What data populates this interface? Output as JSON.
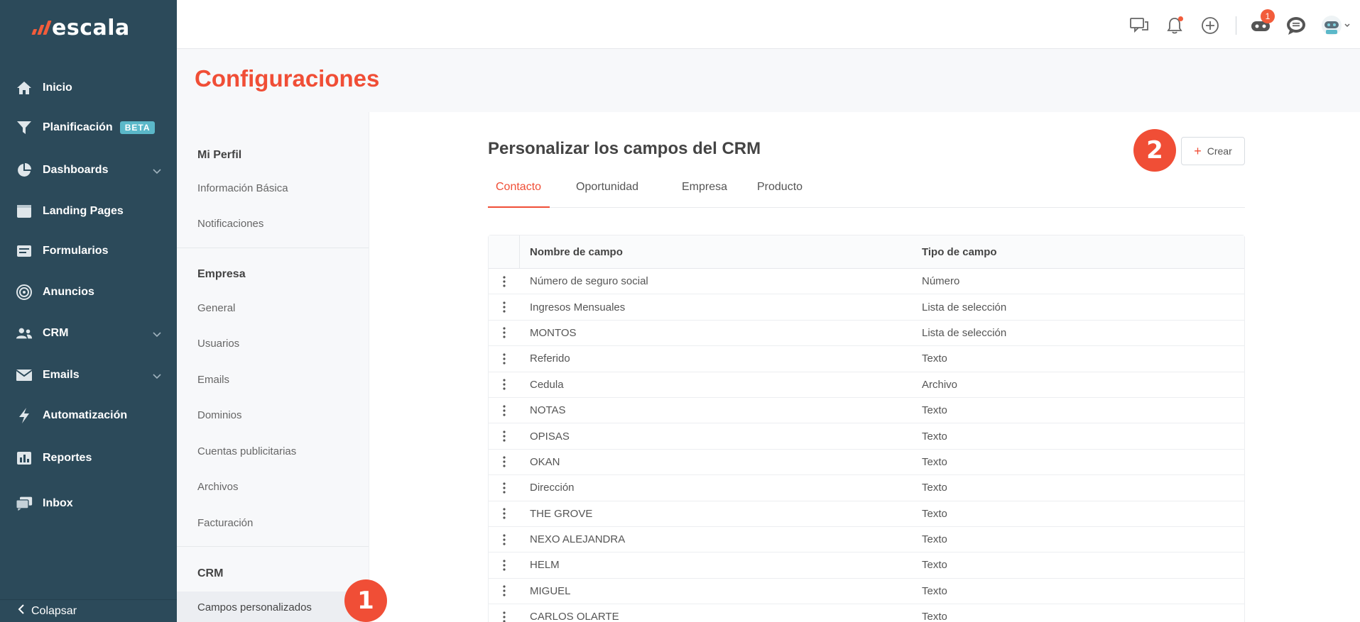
{
  "brand": {
    "name": "escala",
    "accent": "#f04e36",
    "sidebar_bg": "#2c4a5a"
  },
  "sidebar": {
    "items": [
      {
        "label": "Inicio",
        "icon": "home-icon"
      },
      {
        "label": "Planificación",
        "icon": "filter-icon",
        "badge": "BETA"
      },
      {
        "label": "Dashboards",
        "icon": "pie-chart-icon",
        "expandable": true
      },
      {
        "label": "Landing Pages",
        "icon": "browser-icon"
      },
      {
        "label": "Formularios",
        "icon": "form-icon"
      },
      {
        "label": "Anuncios",
        "icon": "target-icon"
      },
      {
        "label": "CRM",
        "icon": "users-icon",
        "expandable": true
      },
      {
        "label": "Emails",
        "icon": "mail-icon",
        "expandable": true
      },
      {
        "label": "Automatización",
        "icon": "lightning-icon"
      },
      {
        "label": "Reportes",
        "icon": "bar-chart-icon"
      },
      {
        "label": "Inbox",
        "icon": "inbox-icon"
      }
    ],
    "collapse_label": "Colapsar"
  },
  "topbar": {
    "icons": [
      "chat-icon",
      "bell-icon",
      "add-circle-icon",
      "robot-icon",
      "support-chat-icon",
      "avatar-icon"
    ],
    "notification_count": "1"
  },
  "page": {
    "title": "Configuraciones"
  },
  "submenu": {
    "sections": [
      {
        "title": "Mi Perfil",
        "items": [
          "Información Básica",
          "Notificaciones"
        ]
      },
      {
        "title": "Empresa",
        "items": [
          "General",
          "Usuarios",
          "Emails",
          "Dominios",
          "Cuentas publicitarias",
          "Archivos",
          "Facturación"
        ]
      },
      {
        "title": "CRM",
        "items": [
          "Campos personalizados"
        ]
      }
    ],
    "active_item": "Campos personalizados"
  },
  "main": {
    "title": "Personalizar los campos del CRM",
    "create_label": "Crear",
    "tabs": [
      "Contacto",
      "Oportunidad",
      "Empresa",
      "Producto"
    ],
    "active_tab": "Contacto",
    "table": {
      "headers": [
        "Nombre de campo",
        "Tipo de campo"
      ],
      "rows": [
        [
          "Número de seguro social",
          "Número"
        ],
        [
          "Ingresos Mensuales",
          "Lista de selección"
        ],
        [
          "MONTOS",
          "Lista de selección"
        ],
        [
          "Referido",
          "Texto"
        ],
        [
          "Cedula",
          "Archivo"
        ],
        [
          "NOTAS",
          "Texto"
        ],
        [
          "OPISAS",
          "Texto"
        ],
        [
          "OKAN",
          "Texto"
        ],
        [
          "Dirección",
          "Texto"
        ],
        [
          "THE GROVE",
          "Texto"
        ],
        [
          "NEXO ALEJANDRA",
          "Texto"
        ],
        [
          "HELM",
          "Texto"
        ],
        [
          "MIGUEL",
          "Texto"
        ],
        [
          "CARLOS OLARTE",
          "Texto"
        ]
      ]
    }
  },
  "steps": {
    "one": "1",
    "two": "2"
  }
}
